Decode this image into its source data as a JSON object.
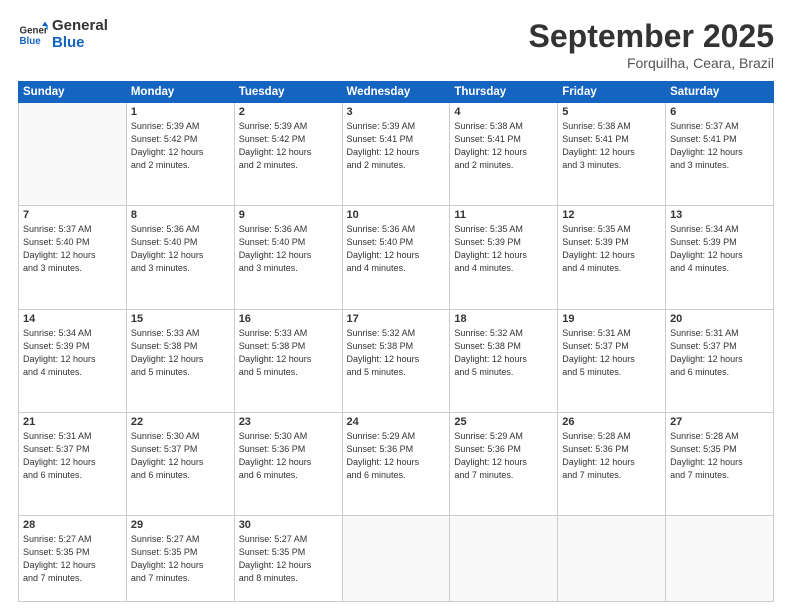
{
  "logo": {
    "line1": "General",
    "line2": "Blue"
  },
  "title": "September 2025",
  "subtitle": "Forquilha, Ceara, Brazil",
  "days_of_week": [
    "Sunday",
    "Monday",
    "Tuesday",
    "Wednesday",
    "Thursday",
    "Friday",
    "Saturday"
  ],
  "weeks": [
    [
      {
        "num": "",
        "info": ""
      },
      {
        "num": "1",
        "info": "Sunrise: 5:39 AM\nSunset: 5:42 PM\nDaylight: 12 hours\nand 2 minutes."
      },
      {
        "num": "2",
        "info": "Sunrise: 5:39 AM\nSunset: 5:42 PM\nDaylight: 12 hours\nand 2 minutes."
      },
      {
        "num": "3",
        "info": "Sunrise: 5:39 AM\nSunset: 5:41 PM\nDaylight: 12 hours\nand 2 minutes."
      },
      {
        "num": "4",
        "info": "Sunrise: 5:38 AM\nSunset: 5:41 PM\nDaylight: 12 hours\nand 2 minutes."
      },
      {
        "num": "5",
        "info": "Sunrise: 5:38 AM\nSunset: 5:41 PM\nDaylight: 12 hours\nand 3 minutes."
      },
      {
        "num": "6",
        "info": "Sunrise: 5:37 AM\nSunset: 5:41 PM\nDaylight: 12 hours\nand 3 minutes."
      }
    ],
    [
      {
        "num": "7",
        "info": "Sunrise: 5:37 AM\nSunset: 5:40 PM\nDaylight: 12 hours\nand 3 minutes."
      },
      {
        "num": "8",
        "info": "Sunrise: 5:36 AM\nSunset: 5:40 PM\nDaylight: 12 hours\nand 3 minutes."
      },
      {
        "num": "9",
        "info": "Sunrise: 5:36 AM\nSunset: 5:40 PM\nDaylight: 12 hours\nand 3 minutes."
      },
      {
        "num": "10",
        "info": "Sunrise: 5:36 AM\nSunset: 5:40 PM\nDaylight: 12 hours\nand 4 minutes."
      },
      {
        "num": "11",
        "info": "Sunrise: 5:35 AM\nSunset: 5:39 PM\nDaylight: 12 hours\nand 4 minutes."
      },
      {
        "num": "12",
        "info": "Sunrise: 5:35 AM\nSunset: 5:39 PM\nDaylight: 12 hours\nand 4 minutes."
      },
      {
        "num": "13",
        "info": "Sunrise: 5:34 AM\nSunset: 5:39 PM\nDaylight: 12 hours\nand 4 minutes."
      }
    ],
    [
      {
        "num": "14",
        "info": "Sunrise: 5:34 AM\nSunset: 5:39 PM\nDaylight: 12 hours\nand 4 minutes."
      },
      {
        "num": "15",
        "info": "Sunrise: 5:33 AM\nSunset: 5:38 PM\nDaylight: 12 hours\nand 5 minutes."
      },
      {
        "num": "16",
        "info": "Sunrise: 5:33 AM\nSunset: 5:38 PM\nDaylight: 12 hours\nand 5 minutes."
      },
      {
        "num": "17",
        "info": "Sunrise: 5:32 AM\nSunset: 5:38 PM\nDaylight: 12 hours\nand 5 minutes."
      },
      {
        "num": "18",
        "info": "Sunrise: 5:32 AM\nSunset: 5:38 PM\nDaylight: 12 hours\nand 5 minutes."
      },
      {
        "num": "19",
        "info": "Sunrise: 5:31 AM\nSunset: 5:37 PM\nDaylight: 12 hours\nand 5 minutes."
      },
      {
        "num": "20",
        "info": "Sunrise: 5:31 AM\nSunset: 5:37 PM\nDaylight: 12 hours\nand 6 minutes."
      }
    ],
    [
      {
        "num": "21",
        "info": "Sunrise: 5:31 AM\nSunset: 5:37 PM\nDaylight: 12 hours\nand 6 minutes."
      },
      {
        "num": "22",
        "info": "Sunrise: 5:30 AM\nSunset: 5:37 PM\nDaylight: 12 hours\nand 6 minutes."
      },
      {
        "num": "23",
        "info": "Sunrise: 5:30 AM\nSunset: 5:36 PM\nDaylight: 12 hours\nand 6 minutes."
      },
      {
        "num": "24",
        "info": "Sunrise: 5:29 AM\nSunset: 5:36 PM\nDaylight: 12 hours\nand 6 minutes."
      },
      {
        "num": "25",
        "info": "Sunrise: 5:29 AM\nSunset: 5:36 PM\nDaylight: 12 hours\nand 7 minutes."
      },
      {
        "num": "26",
        "info": "Sunrise: 5:28 AM\nSunset: 5:36 PM\nDaylight: 12 hours\nand 7 minutes."
      },
      {
        "num": "27",
        "info": "Sunrise: 5:28 AM\nSunset: 5:35 PM\nDaylight: 12 hours\nand 7 minutes."
      }
    ],
    [
      {
        "num": "28",
        "info": "Sunrise: 5:27 AM\nSunset: 5:35 PM\nDaylight: 12 hours\nand 7 minutes."
      },
      {
        "num": "29",
        "info": "Sunrise: 5:27 AM\nSunset: 5:35 PM\nDaylight: 12 hours\nand 7 minutes."
      },
      {
        "num": "30",
        "info": "Sunrise: 5:27 AM\nSunset: 5:35 PM\nDaylight: 12 hours\nand 8 minutes."
      },
      {
        "num": "",
        "info": ""
      },
      {
        "num": "",
        "info": ""
      },
      {
        "num": "",
        "info": ""
      },
      {
        "num": "",
        "info": ""
      }
    ]
  ]
}
